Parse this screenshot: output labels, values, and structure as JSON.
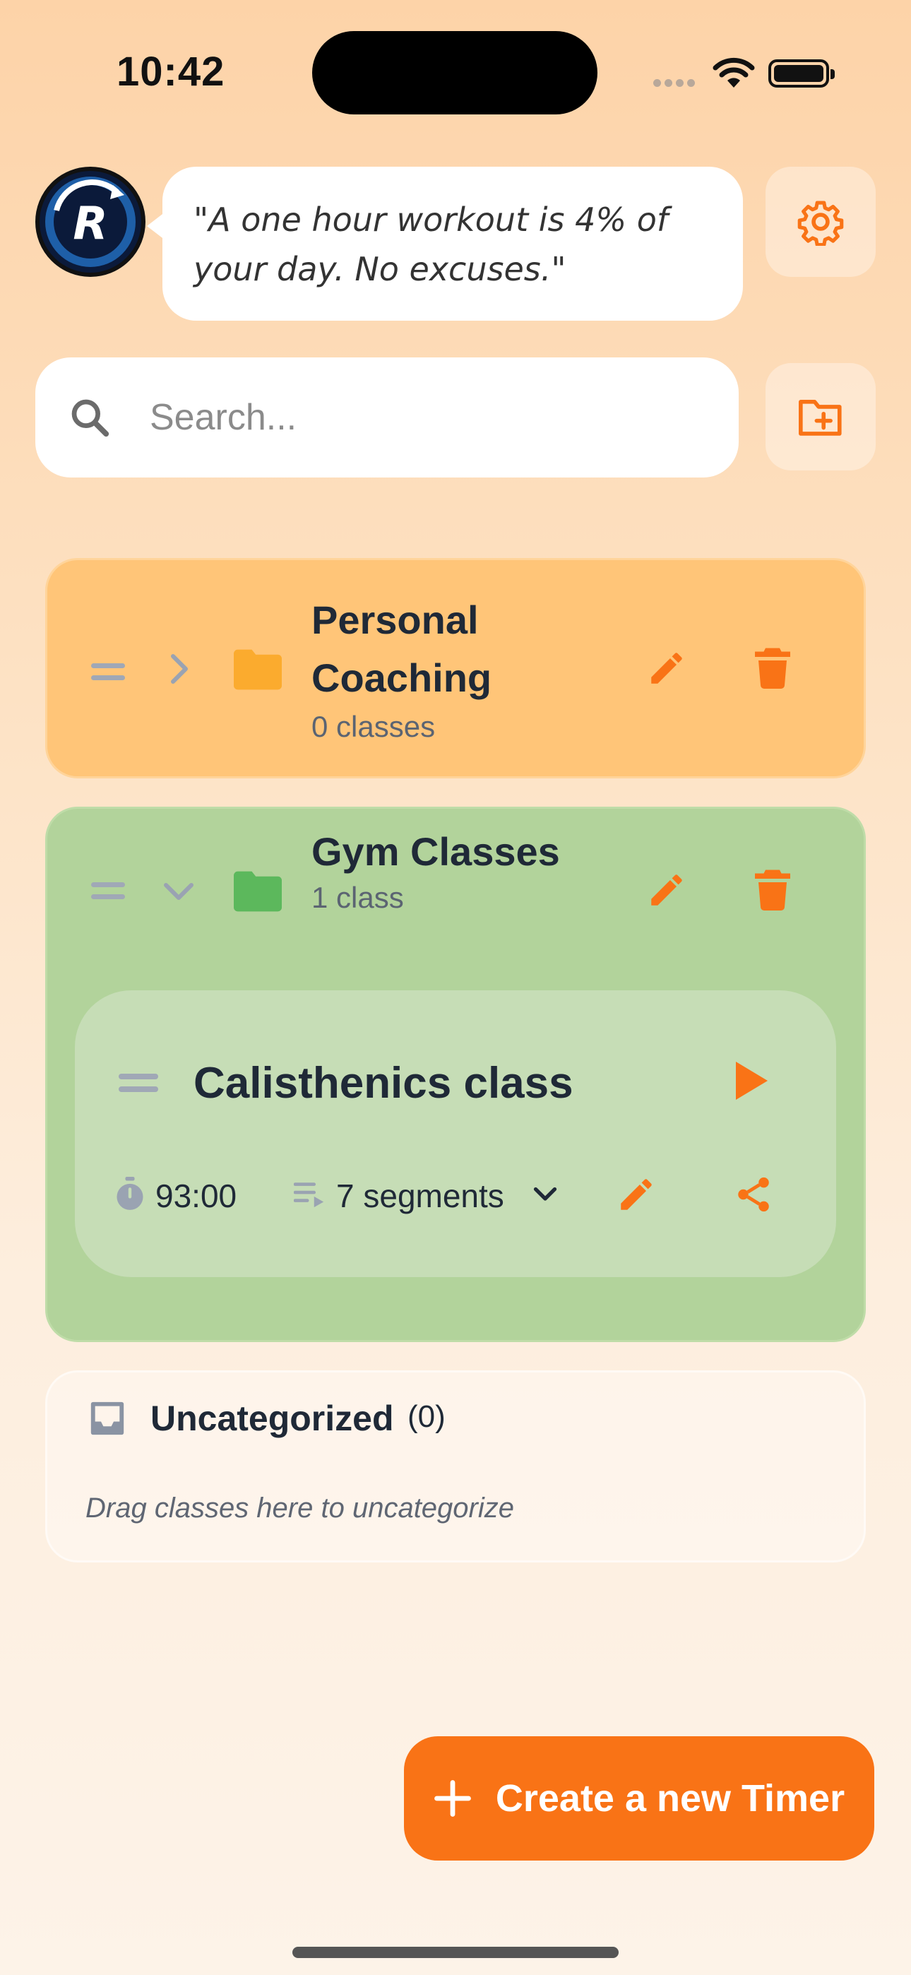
{
  "status_bar": {
    "time": "10:42"
  },
  "header": {
    "quote": "\"A one hour workout is 4% of your day. No excuses.\"",
    "logo_letter": "R"
  },
  "search": {
    "placeholder": "Search..."
  },
  "folders": [
    {
      "name": "Personal Coaching",
      "count_label": "0 classes",
      "color": "#ffc578",
      "icon_color": "#fbab2e",
      "expanded": false
    },
    {
      "name": "Gym Classes",
      "count_label": "1 class",
      "color": "#b2d39b",
      "icon_color": "#5cb85c",
      "expanded": true,
      "classes": [
        {
          "name": "Calisthenics class",
          "duration": "93:00",
          "segments_label": "7 segments"
        }
      ]
    }
  ],
  "uncategorized": {
    "title": "Uncategorized",
    "count": "(0)",
    "hint": "Drag classes here to uncategorize"
  },
  "fab": {
    "label": "Create a new Timer"
  },
  "colors": {
    "accent": "#f97316",
    "personal_folder": "#ffc578",
    "gym_folder": "#b2d39b"
  }
}
